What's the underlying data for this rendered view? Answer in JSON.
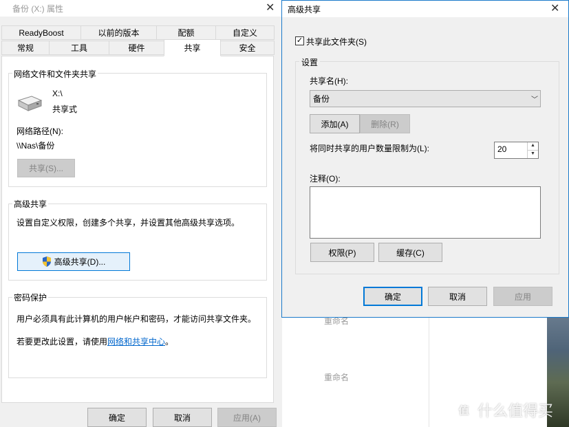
{
  "properties_window": {
    "title": "备份 (X:) 属性",
    "tabs_row1": [
      {
        "label": "ReadyBoost"
      },
      {
        "label": "以前的版本"
      },
      {
        "label": "配额"
      },
      {
        "label": "自定义"
      }
    ],
    "tabs_row2": [
      {
        "label": "常规"
      },
      {
        "label": "工具"
      },
      {
        "label": "硬件"
      },
      {
        "label": "共享",
        "active": true
      },
      {
        "label": "安全"
      }
    ],
    "network_sharing": {
      "heading": "网络文件和文件夹共享",
      "drive_name": "X:\\",
      "share_status": "共享式",
      "path_label": "网络路径(N):",
      "path_value": "\\\\Nas\\备份",
      "share_button": "共享(S)..."
    },
    "advanced_sharing": {
      "heading": "高级共享",
      "description": "设置自定义权限，创建多个共享，并设置其他高级共享选项。",
      "button": "高级共享(D)..."
    },
    "password_protection": {
      "heading": "密码保护",
      "description": "用户必须具有此计算机的用户帐户和密码，才能访问共享文件夹。",
      "change_prefix": "若要更改此设置，请使用",
      "change_link": "网络和共享中心",
      "change_suffix": "。"
    },
    "footer": {
      "ok": "确定",
      "cancel": "取消",
      "apply": "应用(A)"
    }
  },
  "advanced_dialog": {
    "title": "高级共享",
    "share_checkbox": {
      "label": "共享此文件夹(S)",
      "checked": true
    },
    "settings_heading": "设置",
    "share_name_label": "共享名(H):",
    "share_name_value": "备份",
    "add_button": "添加(A)",
    "remove_button": "删除(R)",
    "user_limit_label": "将同时共享的用户数量限制为(L):",
    "user_limit_value": "20",
    "comment_label": "注释(O):",
    "comment_value": "",
    "permissions_button": "权限(P)",
    "caching_button": "缓存(C)",
    "ok": "确定",
    "cancel": "取消",
    "apply": "应用"
  },
  "background": {
    "rename_1": "重命名",
    "rename_2": "重命名",
    "watermark_logo": "值",
    "watermark_text": "什么值得买"
  }
}
